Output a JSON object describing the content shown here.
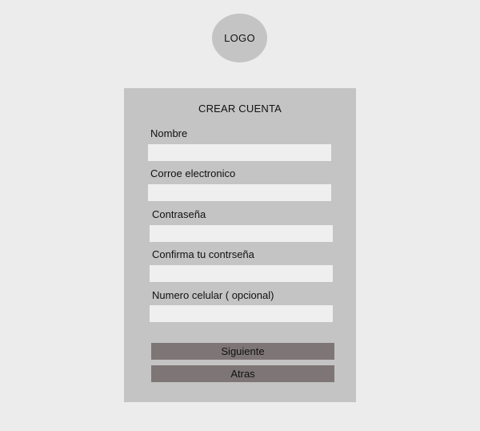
{
  "logo": {
    "text": "LOGO"
  },
  "form": {
    "title": "CREAR CUENTA",
    "fields": [
      {
        "label": "Nombre",
        "value": "",
        "placeholder": ""
      },
      {
        "label": "Corroe electronico",
        "value": "",
        "placeholder": ""
      },
      {
        "label": "Contraseña",
        "value": "",
        "placeholder": ""
      },
      {
        "label": "Confirma tu contrseña",
        "value": "",
        "placeholder": ""
      },
      {
        "label": "Numero celular ( opcional)",
        "value": "",
        "placeholder": ""
      }
    ],
    "buttons": {
      "next_label": "Siguiente",
      "back_label": "Atras"
    }
  },
  "colors": {
    "page_background": "#ececec",
    "card_background": "#c4c4c4",
    "input_background": "#efefef",
    "button_background": "#7e7676"
  }
}
